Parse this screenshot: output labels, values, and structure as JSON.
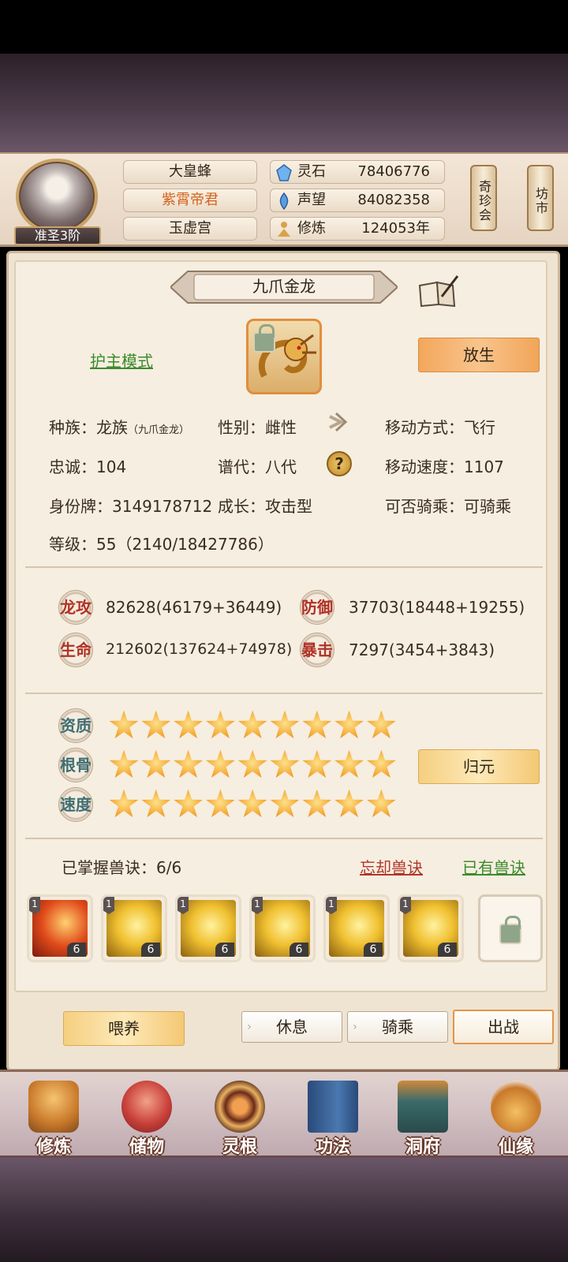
{
  "header": {
    "rank": "准圣3阶",
    "names": [
      "大皇蜂",
      "紫霄帝君",
      "玉虚宫"
    ],
    "resources": [
      {
        "label": "灵石",
        "value": "78406776",
        "icon": "spirit-stone-icon",
        "color": "#5aa0e6"
      },
      {
        "label": "声望",
        "value": "84082358",
        "icon": "prestige-crystal-icon",
        "color": "#4b8fd6"
      },
      {
        "label": "修炼",
        "value": "124053年",
        "icon": "meditation-icon",
        "color": "#d8a24a"
      }
    ],
    "side_buttons": [
      "奇珍会",
      "坊市"
    ]
  },
  "pet": {
    "name": "九爪金龙",
    "mode_link": "护主模式",
    "release_button": "放生",
    "info": {
      "race_label": "种族：龙族",
      "race_sub": "（九爪金龙）",
      "gender": "性别：雌性",
      "move_type": "移动方式：飞行",
      "loyalty": "忠诚：104",
      "generation": "谱代：八代",
      "move_speed": "移动速度：1107",
      "id_tag": "身份牌：3149178712",
      "growth": "成长：攻击型",
      "rideable": "可否骑乘：可骑乘",
      "level": "等级：55（2140/18427786）"
    },
    "stats": [
      {
        "label": "龙攻",
        "value": "82628(46179+36449)"
      },
      {
        "label": "防御",
        "value": "37703(18448+19255)"
      },
      {
        "label": "生命",
        "value": "212602(137624+74978)"
      },
      {
        "label": "暴击",
        "value": "7297(3454+3843)"
      }
    ],
    "qualities": [
      {
        "label": "资质",
        "stars": 9
      },
      {
        "label": "根骨",
        "stars": 9
      },
      {
        "label": "速度",
        "stars": 9
      }
    ],
    "return_button": "归元",
    "skills_mastered": "已掌握兽诀：6/6",
    "forget_link": "忘却兽诀",
    "owned_link": "已有兽诀",
    "skills": [
      {
        "level": "1",
        "count": "6",
        "type": "flame-strike"
      },
      {
        "level": "1",
        "count": "6",
        "type": "golden-dragon"
      },
      {
        "level": "1",
        "count": "6",
        "type": "golden-dragon"
      },
      {
        "level": "1",
        "count": "6",
        "type": "golden-dragon"
      },
      {
        "level": "1",
        "count": "6",
        "type": "golden-dragon"
      },
      {
        "level": "1",
        "count": "6",
        "type": "golden-dragon"
      }
    ]
  },
  "actions": {
    "feed": "喂养",
    "rest": "休息",
    "ride": "骑乘",
    "battle": "出战"
  },
  "nav": [
    "修炼",
    "储物",
    "灵根",
    "功法",
    "洞府",
    "仙缘"
  ]
}
